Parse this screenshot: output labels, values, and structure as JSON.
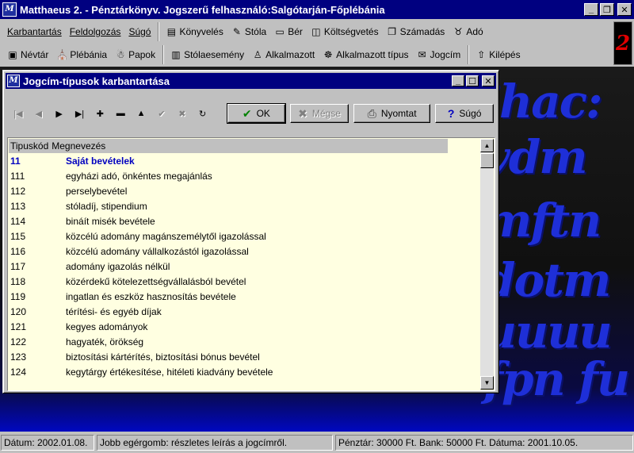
{
  "app": {
    "title": "Matthaeus 2. - Pénztárkönyv. Jogszerű felhasználó:Salgótarján-Főplébánia",
    "icon_glyph": "M",
    "logo_glyph": "2"
  },
  "toolbar1": {
    "menus": [
      "Karbantartás",
      "Feldolgozás",
      "Súgó"
    ],
    "buttons": [
      {
        "label": "Könyvelés",
        "icon": "book-icon",
        "glyph": "▤"
      },
      {
        "label": "Stóla",
        "icon": "pen-icon",
        "glyph": "✎"
      },
      {
        "label": "Bér",
        "icon": "payroll-icon",
        "glyph": "▭"
      },
      {
        "label": "Költségvetés",
        "icon": "budget-icon",
        "glyph": "◫"
      },
      {
        "label": "Számadás",
        "icon": "ledger-icon",
        "glyph": "❐"
      },
      {
        "label": "Adó",
        "icon": "tax-icon",
        "glyph": "♉"
      }
    ]
  },
  "toolbar2": {
    "buttons": [
      {
        "label": "Névtár",
        "icon": "address-book-icon",
        "glyph": "▣"
      },
      {
        "label": "Plébánia",
        "icon": "parish-icon",
        "glyph": "⛪"
      },
      {
        "label": "Papok",
        "icon": "priests-icon",
        "glyph": "☃"
      },
      {
        "label": "Stólaesemény",
        "icon": "stole-event-icon",
        "glyph": "▥"
      },
      {
        "label": "Alkalmazott",
        "icon": "employee-icon",
        "glyph": "♙"
      },
      {
        "label": "Alkalmazott típus",
        "icon": "employee-type-icon",
        "glyph": "☸"
      },
      {
        "label": "Jogcím",
        "icon": "title-icon",
        "glyph": "✉"
      },
      {
        "label": "Kilépés",
        "icon": "exit-icon",
        "glyph": "⇧"
      }
    ]
  },
  "dialog": {
    "title": "Jogcím-típusok karbantartása",
    "nav": [
      {
        "name": "first-record",
        "glyph": "|◀",
        "enabled": false
      },
      {
        "name": "prior-record",
        "glyph": "◀",
        "enabled": false
      },
      {
        "name": "next-record",
        "glyph": "▶",
        "enabled": true
      },
      {
        "name": "last-record",
        "glyph": "▶|",
        "enabled": true
      },
      {
        "name": "insert-record",
        "glyph": "✚",
        "enabled": true
      },
      {
        "name": "delete-record",
        "glyph": "▬",
        "enabled": true
      },
      {
        "name": "edit-record",
        "glyph": "▲",
        "enabled": true
      },
      {
        "name": "post-record",
        "glyph": "✔",
        "enabled": false
      },
      {
        "name": "cancel-edit",
        "glyph": "✖",
        "enabled": false
      },
      {
        "name": "refresh-data",
        "glyph": "↻",
        "enabled": true
      }
    ],
    "buttons": {
      "ok": "OK",
      "cancel": "Mégse",
      "print": "Nyomtat",
      "help": "Súgó"
    },
    "list": {
      "headers": [
        "Tipuskód",
        "Megnevezés"
      ],
      "rows": [
        {
          "code": "11",
          "name": "Saját bevételek",
          "group": true
        },
        {
          "code": "111",
          "name": "egyházi adó, önkéntes megajánlás",
          "group": false
        },
        {
          "code": "112",
          "name": "perselybevétel",
          "group": false
        },
        {
          "code": "113",
          "name": "stóladíj, stipendium",
          "group": false
        },
        {
          "code": "114",
          "name": "bináít misék bevétele",
          "group": false
        },
        {
          "code": "115",
          "name": "közcélú adomány magánszemélytől igazolással",
          "group": false
        },
        {
          "code": "116",
          "name": "közcélú adomány vállalkozástól igazolással",
          "group": false
        },
        {
          "code": "117",
          "name": "adomány igazolás nélkül",
          "group": false
        },
        {
          "code": "118",
          "name": "közérdekű kötelezettségvállalásból bevétel",
          "group": false
        },
        {
          "code": "119",
          "name": "ingatlan és eszköz hasznosítás bevétele",
          "group": false
        },
        {
          "code": "120",
          "name": "térítési- és egyéb díjak",
          "group": false
        },
        {
          "code": "121",
          "name": "kegyes adományok",
          "group": false
        },
        {
          "code": "122",
          "name": "hagyaték, örökség",
          "group": false
        },
        {
          "code": "123",
          "name": "biztosítási kártérítés, biztosítási bónus bevétel",
          "group": false
        },
        {
          "code": "124",
          "name": "kegytárgy értékesítése, hitéleti kiadvány bevétele",
          "group": false
        }
      ]
    }
  },
  "statusbar": {
    "date": "Dátum: 2002.01.08.",
    "hint": "Jobb egérgomb: részletes leírás a jogcímről.",
    "cash": "Pénztár: 30000 Ft. Bank: 50000 Ft. Dátuma: 2001.10.05."
  },
  "colors": {
    "titlebar": "#000080",
    "list_background": "#ffffe1",
    "group_row": "#0000c0",
    "backdrop_gothic": "#1e2fd8"
  }
}
